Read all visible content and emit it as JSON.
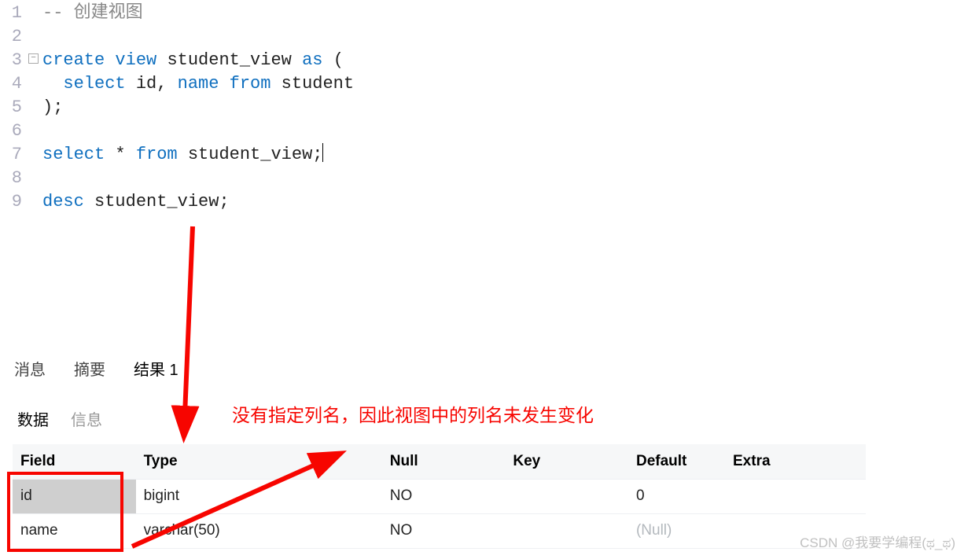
{
  "editor": {
    "fold_glyph": "minus",
    "lines": [
      {
        "n": 1,
        "tokens": [
          {
            "t": "-- ",
            "c": "com"
          },
          {
            "t": "创建视图",
            "c": "com"
          }
        ]
      },
      {
        "n": 2,
        "tokens": []
      },
      {
        "n": 3,
        "tokens": [
          {
            "t": "create view ",
            "c": "kw"
          },
          {
            "t": "student_view ",
            "c": "txt"
          },
          {
            "t": "as ",
            "c": "kw"
          },
          {
            "t": "(",
            "c": "txt"
          }
        ]
      },
      {
        "n": 4,
        "tokens": [
          {
            "t": "  ",
            "c": "txt"
          },
          {
            "t": "select ",
            "c": "kw"
          },
          {
            "t": "id, ",
            "c": "txt"
          },
          {
            "t": "name from ",
            "c": "kw"
          },
          {
            "t": "student",
            "c": "txt"
          }
        ]
      },
      {
        "n": 5,
        "tokens": [
          {
            "t": ");",
            "c": "txt"
          }
        ]
      },
      {
        "n": 6,
        "tokens": []
      },
      {
        "n": 7,
        "tokens": [
          {
            "t": "select ",
            "c": "kw"
          },
          {
            "t": "* ",
            "c": "txt"
          },
          {
            "t": "from ",
            "c": "kw"
          },
          {
            "t": "student_view;",
            "c": "txt"
          }
        ],
        "cursor_after": true
      },
      {
        "n": 8,
        "tokens": []
      },
      {
        "n": 9,
        "tokens": [
          {
            "t": "desc ",
            "c": "kw"
          },
          {
            "t": "student_view;",
            "c": "txt"
          }
        ]
      }
    ]
  },
  "mid_tabs": {
    "items": [
      "消息",
      "摘要",
      "结果 1"
    ],
    "active": 2
  },
  "sub_tabs": {
    "items": [
      "数据",
      "信息"
    ],
    "active": 0
  },
  "table": {
    "headers": [
      "Field",
      "Type",
      "Null",
      "Key",
      "Default",
      "Extra"
    ],
    "rows": [
      {
        "Field": "id",
        "Type": "bigint",
        "Null": "NO",
        "Key": "",
        "Default": "0",
        "Extra": ""
      },
      {
        "Field": "name",
        "Type": "varchar(50)",
        "Null": "NO",
        "Key": "",
        "Default": "(Null)",
        "Extra": ""
      }
    ],
    "null_literal": "(Null)"
  },
  "annotation": {
    "text": "没有指定列名，因此视图中的列名未发生变化"
  },
  "watermark": "CSDN @我要学编程(ಥ_ಥ)"
}
